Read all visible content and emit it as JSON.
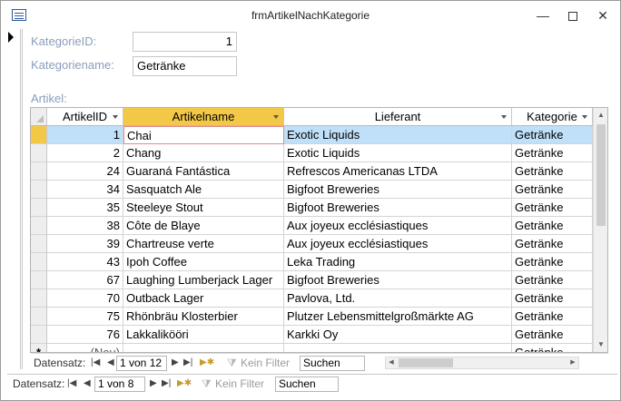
{
  "window": {
    "title": "frmArtikelNachKategorie"
  },
  "form": {
    "kategorie_id_label": "KategorieID:",
    "kategorie_id_value": "1",
    "kategoriename_label": "Kategoriename:",
    "kategoriename_value": "Getränke",
    "artikel_label": "Artikel:"
  },
  "grid": {
    "columns": [
      "ArtikelID",
      "Artikelname",
      "Lieferant",
      "Kategorie"
    ],
    "rows": [
      {
        "id": "1",
        "name": "Chai",
        "supplier": "Exotic Liquids",
        "category": "Getränke"
      },
      {
        "id": "2",
        "name": "Chang",
        "supplier": "Exotic Liquids",
        "category": "Getränke"
      },
      {
        "id": "24",
        "name": "Guaraná Fantástica",
        "supplier": "Refrescos Americanas LTDA",
        "category": "Getränke"
      },
      {
        "id": "34",
        "name": "Sasquatch Ale",
        "supplier": "Bigfoot Breweries",
        "category": "Getränke"
      },
      {
        "id": "35",
        "name": "Steeleye Stout",
        "supplier": "Bigfoot Breweries",
        "category": "Getränke"
      },
      {
        "id": "38",
        "name": "Côte de Blaye",
        "supplier": "Aux joyeux ecclésiastiques",
        "category": "Getränke"
      },
      {
        "id": "39",
        "name": "Chartreuse verte",
        "supplier": "Aux joyeux ecclésiastiques",
        "category": "Getränke"
      },
      {
        "id": "43",
        "name": "Ipoh Coffee",
        "supplier": "Leka Trading",
        "category": "Getränke"
      },
      {
        "id": "67",
        "name": "Laughing Lumberjack Lager",
        "supplier": "Bigfoot Breweries",
        "category": "Getränke"
      },
      {
        "id": "70",
        "name": "Outback Lager",
        "supplier": "Pavlova, Ltd.",
        "category": "Getränke"
      },
      {
        "id": "75",
        "name": "Rhönbräu Klosterbier",
        "supplier": "Plutzer Lebensmittelgroßmärkte AG",
        "category": "Getränke"
      },
      {
        "id": "76",
        "name": "Lakkalikööri",
        "supplier": "Karkki Oy",
        "category": "Getränke"
      }
    ],
    "new_row": {
      "marker": "*",
      "id": "(Neu)",
      "category": "Getränke"
    }
  },
  "sub_nav": {
    "label": "Datensatz:",
    "position": "1 von 12",
    "filter": "Kein Filter",
    "search": "Suchen"
  },
  "main_nav": {
    "label": "Datensatz:",
    "position": "1 von 8",
    "filter": "Kein Filter",
    "search": "Suchen"
  },
  "colors": {
    "selected_header": "#f4c847",
    "current_row": "#bfe0f8",
    "label_text": "#8b9dba"
  }
}
